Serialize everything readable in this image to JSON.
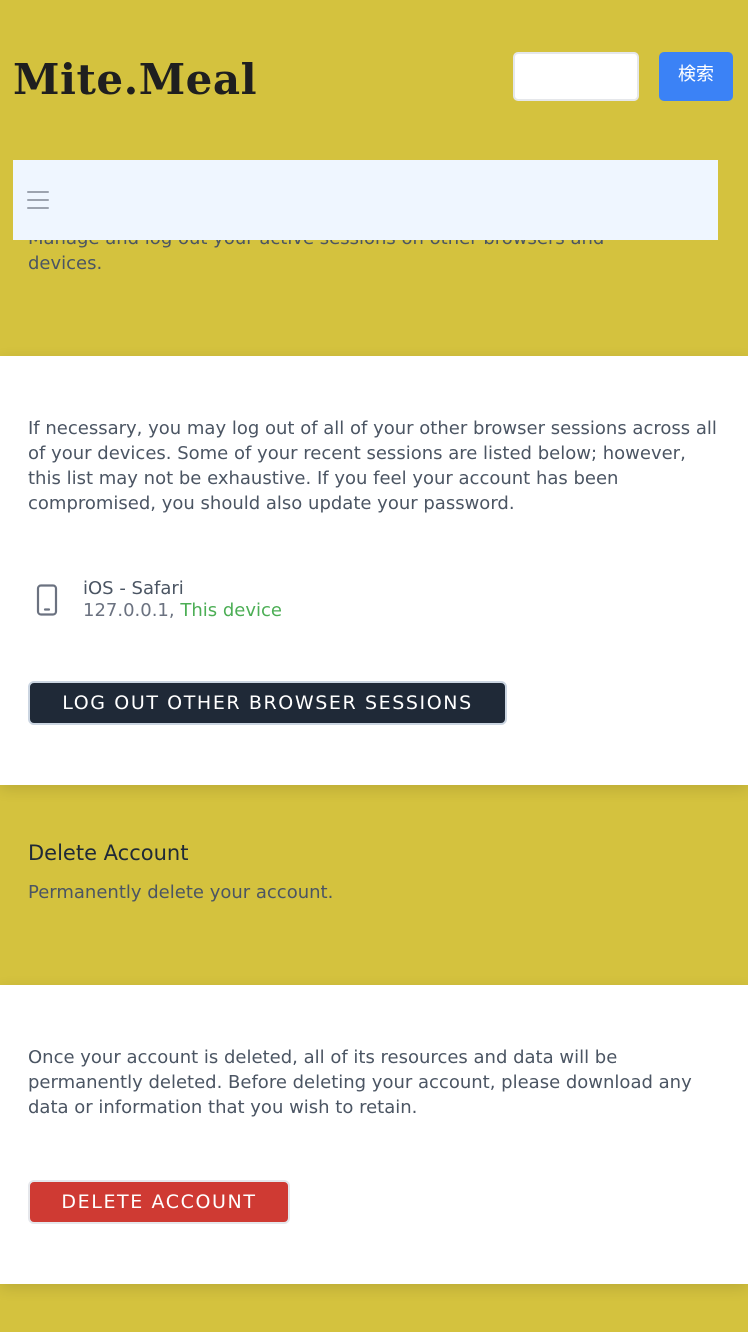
{
  "header": {
    "logo": "Mite.Meal",
    "search": {
      "value": "",
      "placeholder": "",
      "button_label": "検索"
    }
  },
  "navbar": {
    "menu_icon": "hamburger-menu-icon"
  },
  "browser_sessions": {
    "description": "Manage and log out your active sessions on other browsers and devices.",
    "info": "If necessary, you may log out of all of your other browser sessions across all of your devices. Some of your recent sessions are listed below; however, this list may not be exhaustive. If you feel your account has been compromised, you should also update your password.",
    "sessions": [
      {
        "icon": "mobile-phone-icon",
        "device": "iOS - Safari",
        "ip": "127.0.0.1,",
        "current_label": "This device"
      }
    ],
    "logout_button_label": "Log Out Other Browser Sessions"
  },
  "delete_account": {
    "title": "Delete Account",
    "subtitle": "Permanently delete your account.",
    "info": "Once your account is deleted, all of its resources and data will be permanently deleted. Before deleting your account, please download any data or information that you wish to retain.",
    "button_label": "Delete Account"
  },
  "colors": {
    "page_background": "#d4c23e",
    "card_background": "#ffffff",
    "navbar_background": "#eff6ff",
    "search_button": "#3b82f6",
    "dark_button": "#1f2937",
    "danger_button": "#cf3a33",
    "current_device": "#4cae55"
  }
}
